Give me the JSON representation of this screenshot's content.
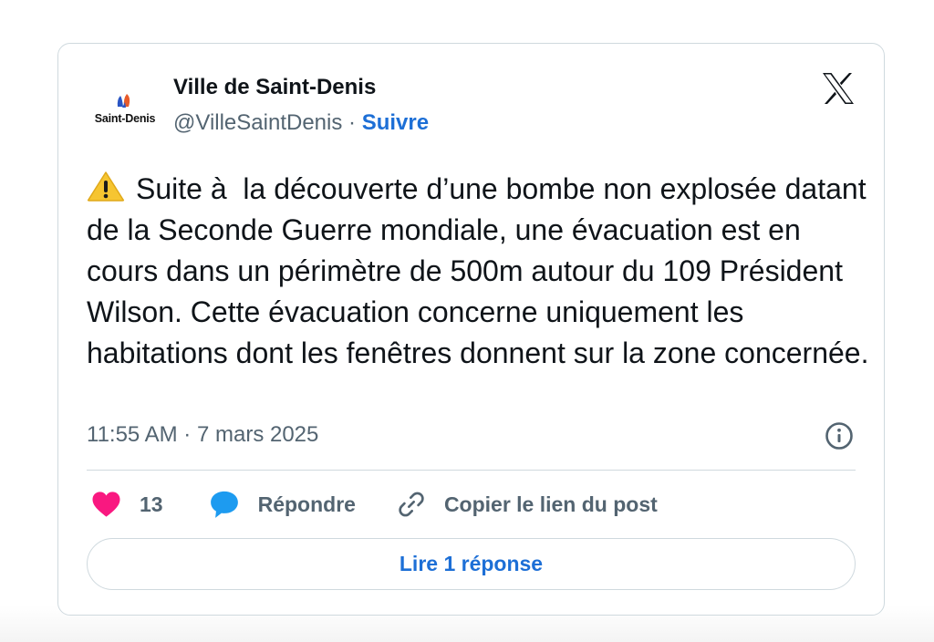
{
  "author": {
    "avatar_text": "Saint-Denis",
    "name": "Ville de Saint-Denis",
    "handle": "@VilleSaintDenis",
    "separator": "·",
    "follow_label": "Suivre"
  },
  "post": {
    "text": "Suite à  la découverte d’une bombe non explosée datant de la Seconde Guerre mondiale, une évacuation est en cours dans un périmètre de 500m autour du 109 Président Wilson. Cette évacuation concerne uniquement les habitations dont les fenêtres donnent sur la zone concernée.",
    "time": "11:55 AM",
    "date": "7 mars 2025",
    "timestamp_separator": "·"
  },
  "actions": {
    "like_count": "13",
    "reply_label": "Répondre",
    "copy_link_label": "Copier le lien du post"
  },
  "read_replies_label": "Lire 1 réponse",
  "icons": {
    "warning": "warning-emoji-icon",
    "logo": "x-logo-icon",
    "info": "info-icon",
    "like": "heart-icon",
    "reply": "speech-bubble-icon",
    "copy": "link-icon"
  },
  "colors": {
    "accent_blue": "#1d6fd6",
    "like_pink": "#f91880",
    "reply_blue": "#1d9bf0",
    "secondary_text": "#536471",
    "border": "#cfd9de"
  }
}
